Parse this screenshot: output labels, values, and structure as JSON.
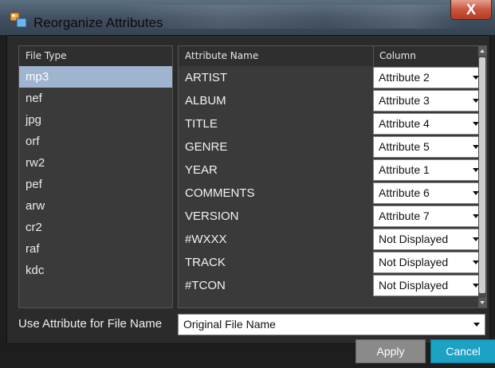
{
  "window": {
    "title": "Reorganize Attributes",
    "close_label": "X"
  },
  "file_types": {
    "header": "File Type",
    "selected": "mp3",
    "items": [
      "mp3",
      "nef",
      "jpg",
      "orf",
      "rw2",
      "pef",
      "arw",
      "cr2",
      "raf",
      "kdc"
    ]
  },
  "attributes": {
    "header_name": "Attribute Name",
    "header_column": "Column",
    "rows": [
      {
        "name": "ARTIST",
        "column": "Attribute 2"
      },
      {
        "name": "ALBUM",
        "column": "Attribute 3"
      },
      {
        "name": "TITLE",
        "column": "Attribute 4"
      },
      {
        "name": "GENRE",
        "column": "Attribute 5"
      },
      {
        "name": "YEAR",
        "column": "Attribute 1"
      },
      {
        "name": "COMMENTS",
        "column": "Attribute 6"
      },
      {
        "name": "VERSION",
        "column": "Attribute 7"
      },
      {
        "name": "#WXXX",
        "column": "Not Displayed"
      },
      {
        "name": "TRACK",
        "column": "Not Displayed"
      },
      {
        "name": "#TCON",
        "column": "Not Displayed"
      }
    ]
  },
  "file_name": {
    "label": "Use Attribute for File Name",
    "value": "Original File Name"
  },
  "buttons": {
    "apply": "Apply",
    "cancel": "Cancel"
  },
  "colors": {
    "selection": "#9fb4cf",
    "cancel_accent": "#1ba2c4",
    "apply_bg": "#8a8a8a",
    "close_red": "#c9563e"
  },
  "icons": {
    "app": "reorganize-attributes-icon",
    "close": "close-icon",
    "dropdown": "chevron-down-icon"
  }
}
